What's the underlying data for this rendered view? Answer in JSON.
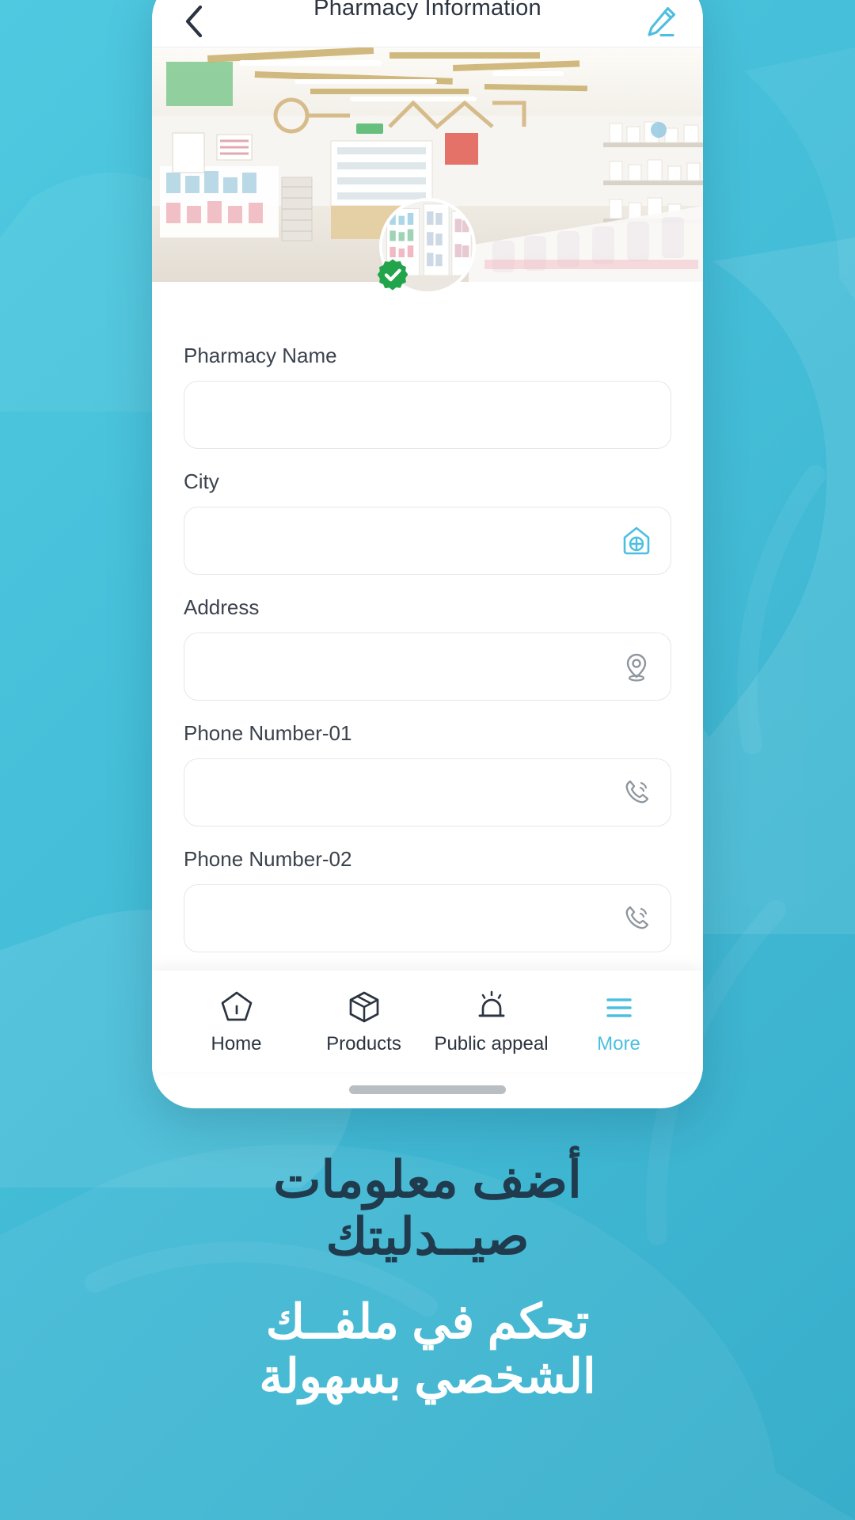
{
  "theme": {
    "bg_gradient_from": "#4fc9e0",
    "bg_gradient_to": "#38aecb",
    "accent": "#4cbfe0",
    "verified_green": "#22a44b",
    "text_dark": "#2b3440",
    "caption_dark": "#1f3b4d",
    "icon_gray": "#8d969e",
    "border": "#e4e7ea"
  },
  "app": {
    "header": {
      "title": "Pharmacy Information",
      "back_icon": "chevron-left-icon",
      "edit_icon": "pencil-edit-icon"
    },
    "banner": {
      "alt": "pharmacy-store-interior-photo"
    },
    "avatar": {
      "alt": "pharmacy-profile-photo",
      "verified_icon": "verified-check-badge"
    },
    "form": {
      "fields": [
        {
          "label": "Pharmacy Name",
          "value": "",
          "placeholder": "",
          "icon": null,
          "icon_color": null
        },
        {
          "label": "City",
          "value": "",
          "placeholder": "",
          "icon": "building-home-icon",
          "icon_color": "#4cbfe0"
        },
        {
          "label": "Address",
          "value": "",
          "placeholder": "",
          "icon": "location-pin-icon",
          "icon_color": "#8d969e"
        },
        {
          "label": "Phone Number-01",
          "value": "",
          "placeholder": "",
          "icon": "phone-call-icon",
          "icon_color": "#8d969e"
        },
        {
          "label": "Phone Number-02",
          "value": "",
          "placeholder": "",
          "icon": "phone-call-icon",
          "icon_color": "#8d969e"
        }
      ]
    },
    "bottom_nav": {
      "items": [
        {
          "label": "Home",
          "icon": "home-pentagon-icon",
          "active": false
        },
        {
          "label": "Products",
          "icon": "package-box-icon",
          "active": false
        },
        {
          "label": "Public appeal",
          "icon": "alarm-siren-icon",
          "active": false
        },
        {
          "label": "More",
          "icon": "hamburger-menu-icon",
          "active": true
        }
      ]
    }
  },
  "promo": {
    "headline_dark_line1": "أضف معلومات",
    "headline_dark_line2": "صيــدليتك",
    "headline_light_line1": "تحكم في ملفــك",
    "headline_light_line2": "الشخصي بسهولة"
  }
}
